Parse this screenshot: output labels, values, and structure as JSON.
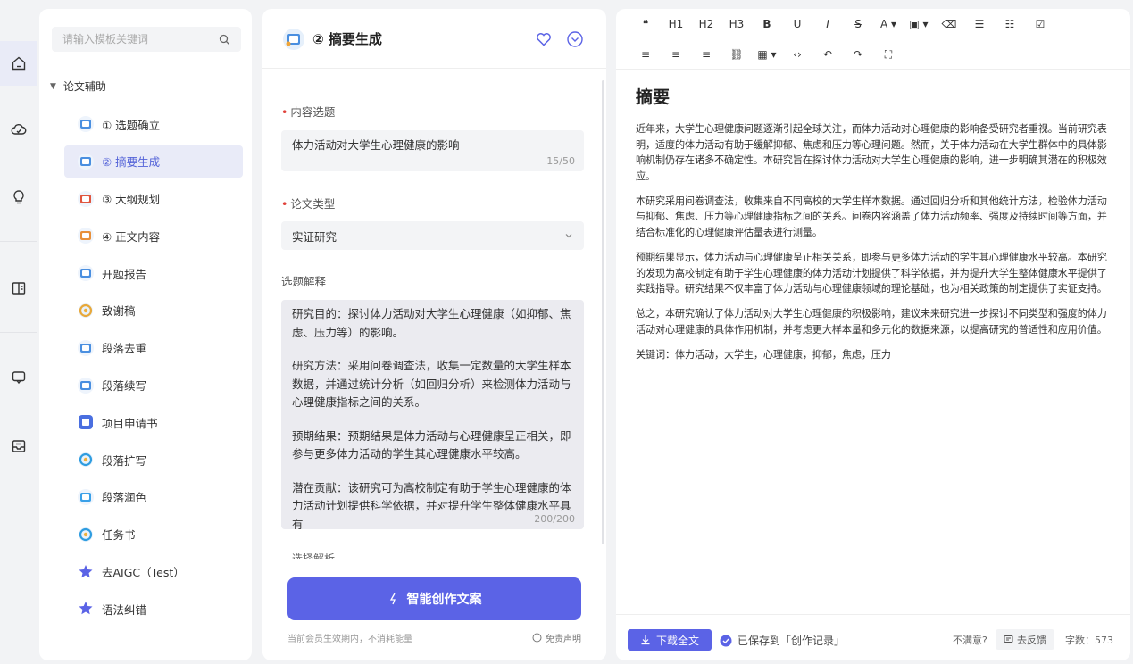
{
  "rail": {
    "icons": [
      "home-icon",
      "cloud-icon",
      "lightbulb-icon",
      "book-icon",
      "chat-icon",
      "inbox-icon"
    ]
  },
  "templates": {
    "search_placeholder": "请输入模板关键词",
    "group_label": "论文辅助",
    "items": [
      {
        "label": "① 选题确立",
        "icon": "topic-icon",
        "color": "#4a8fe0"
      },
      {
        "label": "② 摘要生成",
        "icon": "abstract-icon",
        "color": "#4a8fe0"
      },
      {
        "label": "③ 大纲规划",
        "icon": "outline-icon",
        "color": "#e0563f"
      },
      {
        "label": "④ 正文内容",
        "icon": "content-icon",
        "color": "#e8903a"
      },
      {
        "label": "开题报告",
        "icon": "report-icon",
        "color": "#4a8fe0"
      },
      {
        "label": "致谢稿",
        "icon": "thanks-icon",
        "color": "#e8a83a"
      },
      {
        "label": "段落去重",
        "icon": "dedupe-icon",
        "color": "#4a8fe0"
      },
      {
        "label": "段落续写",
        "icon": "continue-icon",
        "color": "#4a8fe0"
      },
      {
        "label": "项目申请书",
        "icon": "application-icon",
        "color": "#4a6fe0"
      },
      {
        "label": "段落扩写",
        "icon": "expand-icon",
        "color": "#2f9de0"
      },
      {
        "label": "段落润色",
        "icon": "polish-icon",
        "color": "#3aa0e8"
      },
      {
        "label": "任务书",
        "icon": "task-icon",
        "color": "#2f9de0"
      },
      {
        "label": "去AIGC（Test）",
        "icon": "star-icon",
        "color": "#5b63e6"
      },
      {
        "label": "语法纠错",
        "icon": "star-icon",
        "color": "#5b63e6"
      }
    ]
  },
  "form": {
    "title": "② 摘要生成",
    "topic_label": "内容选题",
    "topic_value": "体力活动对大学生心理健康的影响",
    "topic_count": "15/50",
    "type_label": "论文类型",
    "type_value": "实证研究",
    "desc_label": "选题解释",
    "desc_paragraphs": [
      "研究目的：探讨体力活动对大学生心理健康（如抑郁、焦虑、压力等）的影响。",
      "研究方法：采用问卷调查法，收集一定数量的大学生样本数据，并通过统计分析（如回归分析）来检测体力活动与心理健康指标之间的关系。",
      "预期结果：预期结果是体力活动与心理健康呈正相关，即参与更多体力活动的学生其心理健康水平较高。",
      "潜在贡献：该研究可为高校制定有助于学生心理健康的体力活动计划提供科学依据，并对提升学生整体健康水平具有"
    ],
    "desc_count": "200/200",
    "cut_label": "选择解析",
    "generate_label": "智能创作文案",
    "note": "当前会员生效期内，不消耗能量",
    "disclaimer": "免责声明"
  },
  "editor": {
    "toolbar_row1": [
      {
        "name": "quote-icon",
        "text": "❝"
      },
      {
        "name": "h1-button",
        "text": "H1"
      },
      {
        "name": "h2-button",
        "text": "H2"
      },
      {
        "name": "h3-button",
        "text": "H3"
      },
      {
        "name": "bold-button",
        "text": "B"
      },
      {
        "name": "underline-button",
        "text": "U"
      },
      {
        "name": "italic-button",
        "text": "I"
      },
      {
        "name": "strikethrough-button",
        "text": "S"
      },
      {
        "name": "font-color-button",
        "text": "A ▾"
      },
      {
        "name": "bg-color-button",
        "text": "▣ ▾"
      },
      {
        "name": "eraser-icon",
        "text": "⌫"
      },
      {
        "name": "bullet-list-icon",
        "text": "☰"
      },
      {
        "name": "ordered-list-icon",
        "text": "☷"
      },
      {
        "name": "checklist-icon",
        "text": "☑"
      }
    ],
    "toolbar_row2": [
      {
        "name": "align-left-icon",
        "text": "≡"
      },
      {
        "name": "align-center-icon",
        "text": "≡"
      },
      {
        "name": "align-right-icon",
        "text": "≡"
      },
      {
        "name": "link-icon",
        "text": "⛓"
      },
      {
        "name": "table-icon",
        "text": "▦ ▾"
      },
      {
        "name": "code-icon",
        "text": "‹›"
      },
      {
        "name": "undo-icon",
        "text": "↶"
      },
      {
        "name": "redo-icon",
        "text": "↷"
      },
      {
        "name": "fullscreen-icon",
        "text": "⛶"
      }
    ],
    "heading": "摘要",
    "paragraphs": [
      "近年来，大学生心理健康问题逐渐引起全球关注，而体力活动对心理健康的影响备受研究者重视。当前研究表明，适度的体力活动有助于缓解抑郁、焦虑和压力等心理问题。然而，关于体力活动在大学生群体中的具体影响机制仍存在诸多不确定性。本研究旨在探讨体力活动对大学生心理健康的影响，进一步明确其潜在的积极效应。",
      "本研究采用问卷调查法，收集来自不同高校的大学生样本数据。通过回归分析和其他统计方法，检验体力活动与抑郁、焦虑、压力等心理健康指标之间的关系。问卷内容涵盖了体力活动频率、强度及持续时间等方面，并结合标准化的心理健康评估量表进行测量。",
      "预期结果显示，体力活动与心理健康呈正相关关系，即参与更多体力活动的学生其心理健康水平较高。本研究的发现为高校制定有助于学生心理健康的体力活动计划提供了科学依据，并为提升大学生整体健康水平提供了实践指导。研究结果不仅丰富了体力活动与心理健康领域的理论基础，也为相关政策的制定提供了实证支持。",
      "总之，本研究确认了体力活动对大学生心理健康的积极影响，建议未来研究进一步探讨不同类型和强度的体力活动对心理健康的具体作用机制，并考虑更大样本量和多元化的数据来源，以提高研究的普适性和应用价值。",
      "关键词：体力活动，大学生，心理健康，抑郁，焦虑，压力"
    ],
    "download_label": "下载全文",
    "saved_text": "已保存到「创作记录」",
    "unsatisfied": "不满意?",
    "feedback_label": "去反馈",
    "word_count": "字数：573"
  }
}
